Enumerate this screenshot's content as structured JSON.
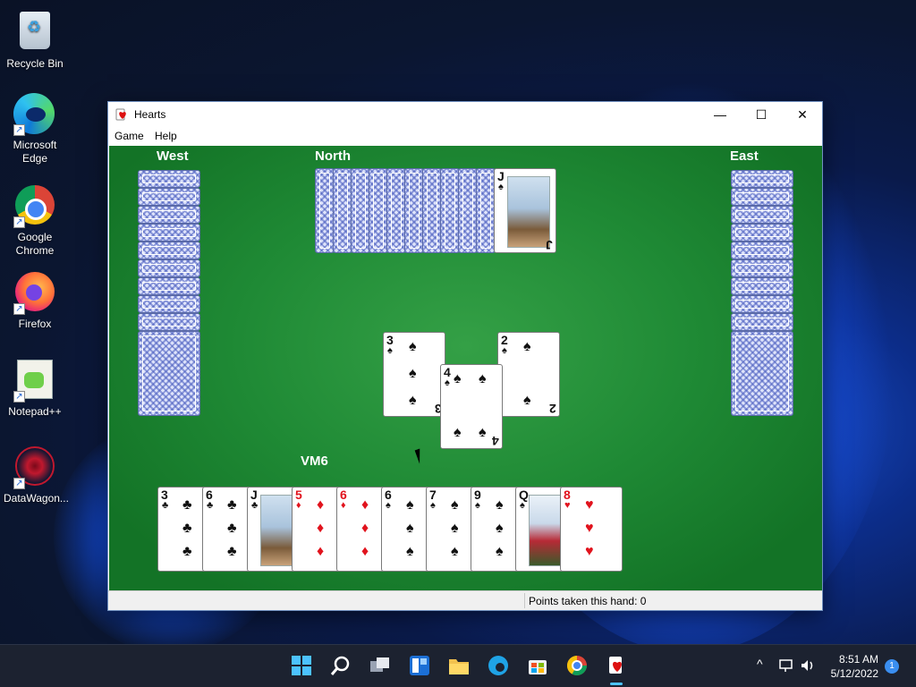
{
  "desktop": {
    "icons": [
      {
        "label": "Recycle Bin",
        "icon": "recycle-bin-icon"
      },
      {
        "label": "Microsoft Edge",
        "icon": "edge-icon"
      },
      {
        "label": "Google Chrome",
        "icon": "chrome-icon"
      },
      {
        "label": "Firefox",
        "icon": "firefox-icon"
      },
      {
        "label": "Notepad++",
        "icon": "notepad-plus-plus-icon"
      },
      {
        "label": "DataWagon...",
        "icon": "datawagon-icon"
      }
    ]
  },
  "window": {
    "title": "Hearts",
    "menu": [
      "Game",
      "Help"
    ],
    "controls": {
      "minimize": "—",
      "maximize": "☐",
      "close": "✕"
    }
  },
  "game": {
    "players": {
      "west": "West",
      "north": "North",
      "east": "East",
      "south": "VM6"
    },
    "north_hand": {
      "back_count": 10,
      "face_card": {
        "rank": "J",
        "suit": "♠"
      }
    },
    "west_hand_count": 10,
    "east_hand_count": 10,
    "trick": [
      {
        "rank": "3",
        "suit": "♠"
      },
      {
        "rank": "4",
        "suit": "♠"
      },
      {
        "rank": "2",
        "suit": "♠"
      }
    ],
    "hand": [
      {
        "rank": "3",
        "suit": "♣"
      },
      {
        "rank": "6",
        "suit": "♣"
      },
      {
        "rank": "J",
        "suit": "♣"
      },
      {
        "rank": "5",
        "suit": "♦"
      },
      {
        "rank": "6",
        "suit": "♦"
      },
      {
        "rank": "6",
        "suit": "♠"
      },
      {
        "rank": "7",
        "suit": "♠"
      },
      {
        "rank": "9",
        "suit": "♠"
      },
      {
        "rank": "Q",
        "suit": "♠"
      },
      {
        "rank": "8",
        "suit": "♥"
      }
    ]
  },
  "status": {
    "text": "Points taken this hand: 0"
  },
  "taskbar": {
    "time": "8:51 AM",
    "date": "5/12/2022",
    "notifications": "1",
    "tray_arrow": "^"
  }
}
